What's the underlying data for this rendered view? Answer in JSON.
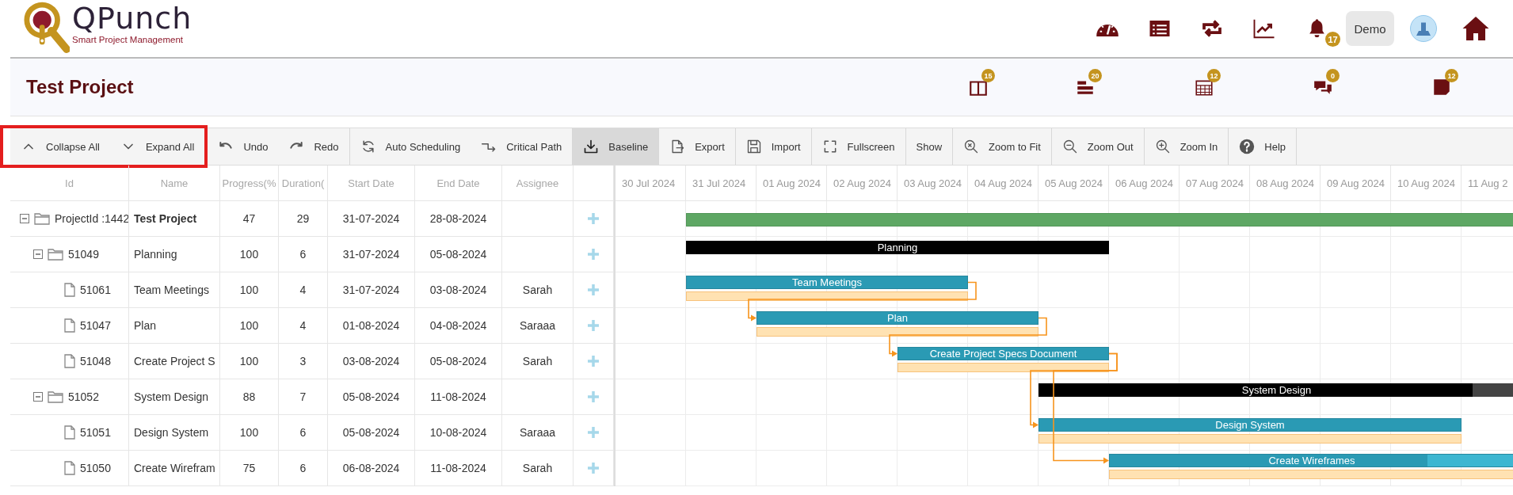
{
  "header": {
    "logo": {
      "title": "QPunch",
      "subtitle": "Smart Project Management"
    },
    "nav_icons": [
      {
        "kind": "gauge"
      },
      {
        "kind": "list"
      },
      {
        "kind": "repeat"
      },
      {
        "kind": "chart"
      },
      {
        "kind": "bell",
        "badge": "17"
      }
    ],
    "user_button": "Demo",
    "end_icons": [
      {
        "kind": "avatar"
      },
      {
        "kind": "home"
      }
    ]
  },
  "project": {
    "title": "Test Project",
    "modules": [
      {
        "kind": "board",
        "badge": "15"
      },
      {
        "kind": "stack",
        "badge": "20"
      },
      {
        "kind": "calendar",
        "badge": "12"
      },
      {
        "kind": "chat",
        "badge": "0"
      },
      {
        "kind": "note",
        "badge": "12"
      }
    ]
  },
  "toolbar": [
    {
      "highlighted": true,
      "items": [
        {
          "kind": "collapse",
          "label": "Collapse All",
          "selected": false
        },
        {
          "kind": "expand",
          "label": "Expand All",
          "selected": false
        }
      ]
    },
    {
      "items": [
        {
          "kind": "undo",
          "label": "Undo",
          "selected": false
        },
        {
          "kind": "redo",
          "label": "Redo",
          "selected": false
        }
      ]
    },
    {
      "items": [
        {
          "kind": "auto",
          "label": "Auto Scheduling",
          "selected": false
        },
        {
          "kind": "critical",
          "label": "Critical Path",
          "selected": false
        }
      ]
    },
    {
      "items": [
        {
          "kind": "baseline",
          "label": "Baseline",
          "selected": true
        }
      ]
    },
    {
      "items": [
        {
          "kind": "export",
          "label": "Export",
          "selected": false
        }
      ]
    },
    {
      "items": [
        {
          "kind": "import",
          "label": "Import",
          "selected": false
        }
      ]
    },
    {
      "items": [
        {
          "kind": "fullscreen",
          "label": "Fullscreen",
          "selected": false
        }
      ]
    },
    {
      "items": [
        {
          "kind": "show",
          "label": "Show",
          "selected": false
        }
      ]
    },
    {
      "items": [
        {
          "kind": "zoomfit",
          "label": "Zoom to Fit",
          "selected": false
        }
      ]
    },
    {
      "items": [
        {
          "kind": "zoomout",
          "label": "Zoom Out",
          "selected": false
        }
      ]
    },
    {
      "items": [
        {
          "kind": "zoomin",
          "label": "Zoom In",
          "selected": false
        }
      ]
    },
    {
      "items": [
        {
          "kind": "help",
          "label": "Help",
          "selected": false
        }
      ]
    }
  ],
  "grid": {
    "columns": [
      "Id",
      "Name",
      "Progress(%",
      "Duration(",
      "Start Date",
      "End Date",
      "Assignee"
    ],
    "rows": [
      {
        "kind": "project",
        "id": "ProjectId :1442",
        "name": "Test Project",
        "progress": "47",
        "duration": "29",
        "start": "31-07-2024",
        "end": "28-08-2024",
        "expanded": true,
        "children": [
          {
            "kind": "group",
            "id": "51049",
            "name": "Planning",
            "progress": "100",
            "duration": "6",
            "start": "31-07-2024",
            "end": "05-08-2024",
            "expanded": true,
            "level": 1,
            "bar_label": "Planning",
            "children": [
              {
                "kind": "task",
                "id": "51061",
                "name": "Team Meetings",
                "progress": "100",
                "duration": "4",
                "start": "31-07-2024",
                "end": "03-08-2024",
                "assignee": "Sarah",
                "level": 1,
                "bar_label": "Team Meetings"
              },
              {
                "kind": "task",
                "id": "51047",
                "name": "Plan",
                "progress": "100",
                "duration": "4",
                "start": "01-08-2024",
                "end": "04-08-2024",
                "assignee": "Saraaa",
                "level": 1,
                "bar_label": "Plan",
                "link_from_previous": true
              },
              {
                "kind": "task",
                "id": "51048",
                "name": "Create Project S",
                "progress": "100",
                "duration": "3",
                "start": "03-08-2024",
                "end": "05-08-2024",
                "assignee": "Sarah",
                "level": 1,
                "bar_label": "Create Project Specs Document",
                "link_from_previous": true,
                "link_from_before_previous": false
              }
            ]
          },
          {
            "kind": "group",
            "id": "51052",
            "name": "System Design",
            "progress": "88",
            "duration": "7",
            "start": "05-08-2024",
            "end": "11-08-2024",
            "expanded": true,
            "level": 0.88,
            "bar_label": "System Design",
            "children": [
              {
                "kind": "task",
                "id": "51051",
                "name": "Design System",
                "progress": "100",
                "duration": "6",
                "start": "05-08-2024",
                "end": "10-08-2024",
                "assignee": "Saraaa",
                "level": 1,
                "bar_label": "Design System",
                "link_from_previous": true,
                "link_from_before_previous": false
              },
              {
                "kind": "task",
                "id": "51050",
                "name": "Create Wirefram",
                "progress": "75",
                "duration": "6",
                "start": "06-08-2024",
                "end": "11-08-2024",
                "assignee": "Sarah",
                "level": 0.75,
                "bar_label": "Create Wireframes",
                "link_from_previous": false,
                "link_from_before_previous": true
              }
            ]
          }
        ]
      }
    ]
  },
  "timeline": [
    "30 Jul 2024",
    "31 Jul 2024",
    "01 Aug 2024",
    "02 Aug 2024",
    "03 Aug 2024",
    "04 Aug 2024",
    "05 Aug 2024",
    "06 Aug 2024",
    "07 Aug 2024",
    "08 Aug 2024",
    "09 Aug 2024",
    "10 Aug 2024",
    "11 Aug 2"
  ]
}
